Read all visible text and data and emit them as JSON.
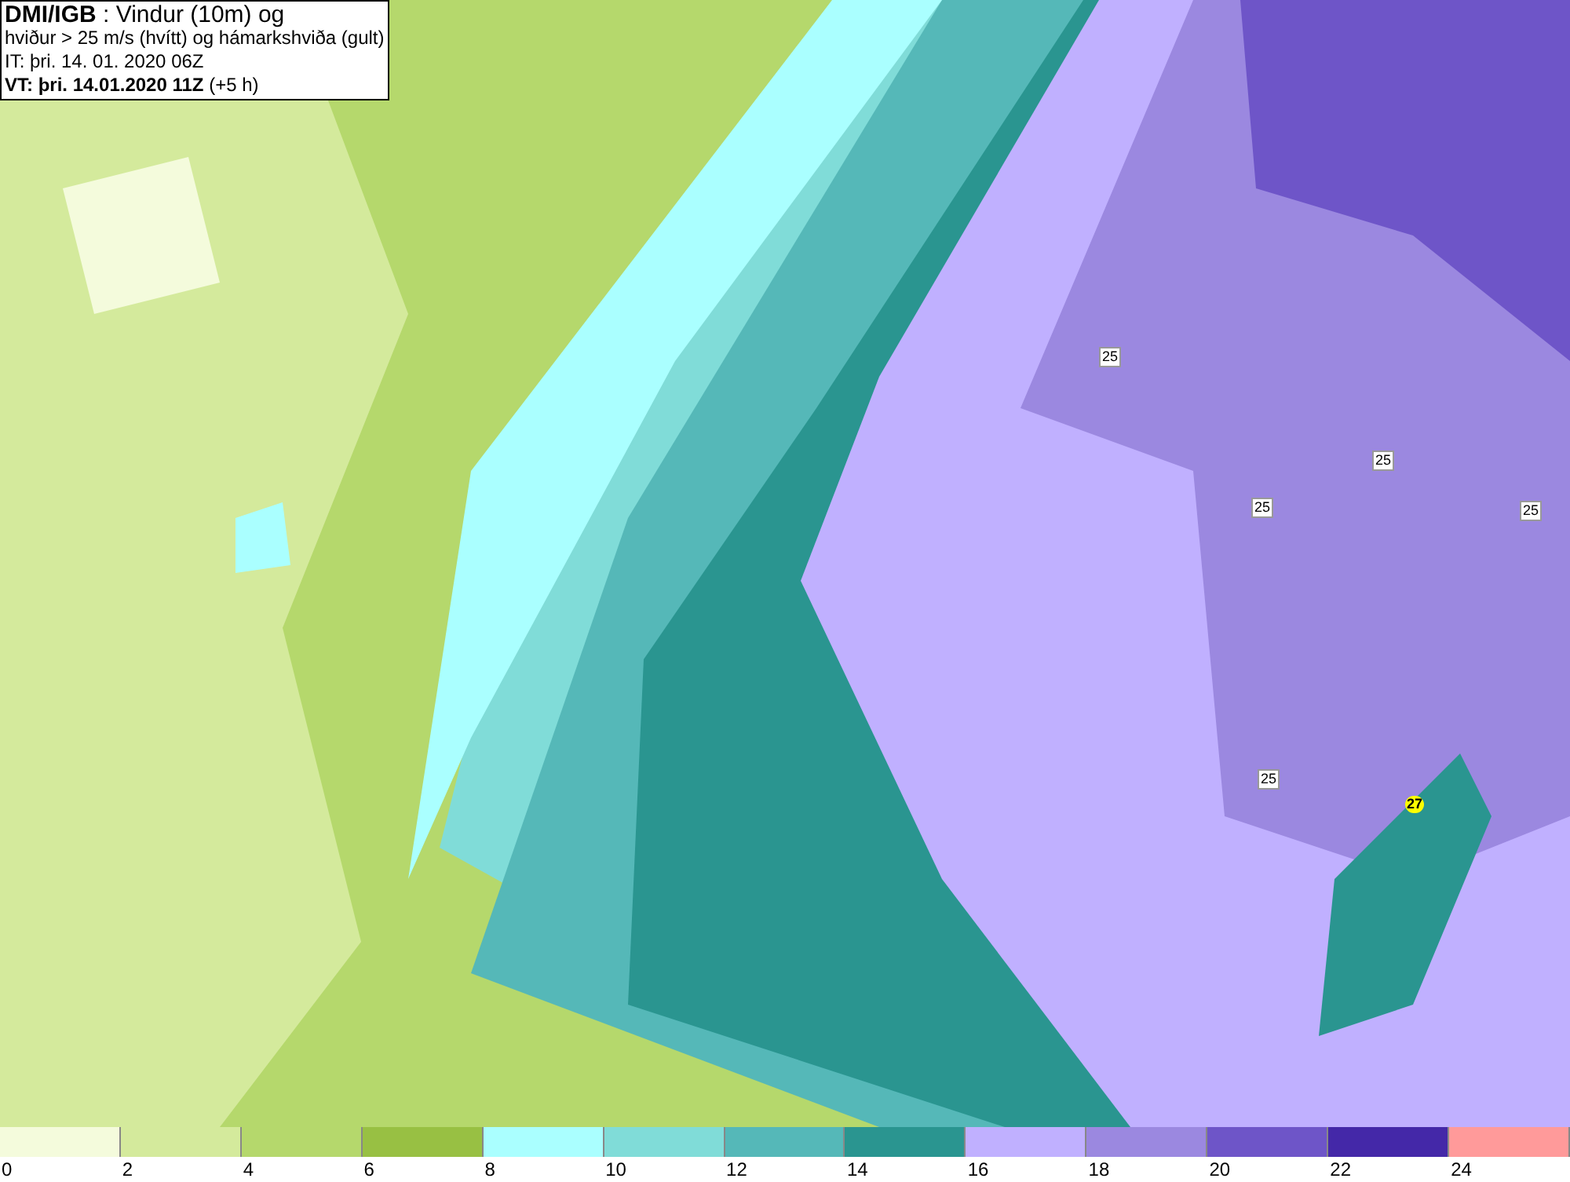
{
  "title_box": {
    "lines": [
      "**DMI/IGB** : Vindur (10m) og",
      "hviður > 25 m/s (hvítt) og hámarkshviða (gult)",
      "IT: þri. 14. 01. 2020 06Z",
      "**VT: þri. 14.01.2020 11Z** (+5 h)"
    ]
  },
  "map": {
    "labels": [
      {
        "text": "25",
        "kind": "gust"
      },
      {
        "text": "25",
        "kind": "gust"
      },
      {
        "text": "25",
        "kind": "gust"
      },
      {
        "text": "25",
        "kind": "gust"
      },
      {
        "text": "25",
        "kind": "gust"
      },
      {
        "text": "27",
        "kind": "max"
      }
    ]
  },
  "legend": {
    "bins": [
      {
        "label": "0",
        "color": "#f4fbdc"
      },
      {
        "label": "2",
        "color": "#d4ea9c"
      },
      {
        "label": "4",
        "color": "#b5d86c"
      },
      {
        "label": "6",
        "color": "#98c043"
      },
      {
        "label": "8",
        "color": "#aaffff"
      },
      {
        "label": "10",
        "color": "#80dcd8"
      },
      {
        "label": "12",
        "color": "#55b8b8"
      },
      {
        "label": "14",
        "color": "#2a9590"
      },
      {
        "label": "16",
        "color": "#c0b0ff"
      },
      {
        "label": "18",
        "color": "#9b88e0"
      },
      {
        "label": "20",
        "color": "#6e55c8"
      },
      {
        "label": "22",
        "color": "#4428a8"
      },
      {
        "label": "24",
        "color": "#ff9a9a"
      }
    ]
  }
}
